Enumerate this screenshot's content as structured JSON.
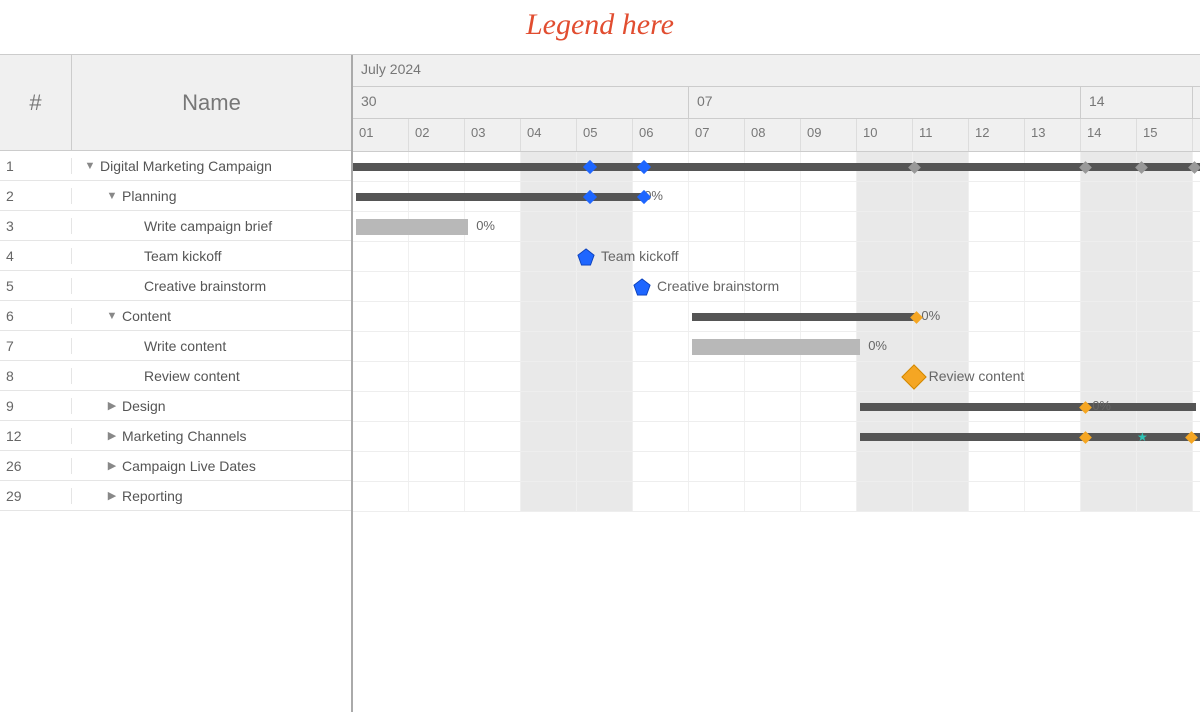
{
  "title": "Legend here",
  "columns": {
    "num": "#",
    "name": "Name"
  },
  "month": "July 2024",
  "weeks": [
    "30",
    "07",
    "14"
  ],
  "days": [
    "01",
    "02",
    "03",
    "04",
    "05",
    "06",
    "07",
    "08",
    "09",
    "10",
    "11",
    "12",
    "13",
    "14",
    "15"
  ],
  "weekend_day_indices": [
    3,
    4,
    9,
    10,
    13,
    14
  ],
  "rows": [
    {
      "num": "1",
      "indent": 0,
      "toggle": "down",
      "name": "Digital Marketing Campaign",
      "bar": {
        "type": "parent",
        "start": 0,
        "span": 15.5
      },
      "markers": [
        {
          "t": "dia-blue",
          "at": 4.15
        },
        {
          "t": "dia-blue",
          "at": 5.1
        },
        {
          "t": "dia-grey",
          "at": 9.95
        },
        {
          "t": "dia-grey",
          "at": 13.0
        },
        {
          "t": "dia-grey",
          "at": 14.0
        },
        {
          "t": "dia-grey",
          "at": 14.95
        }
      ]
    },
    {
      "num": "2",
      "indent": 1,
      "toggle": "down",
      "name": "Planning",
      "bar": {
        "type": "parent",
        "start": 0.05,
        "span": 5.1
      },
      "pct": {
        "val": "0%",
        "at": 5.2
      },
      "markers": [
        {
          "t": "dia-blue",
          "at": 4.15
        },
        {
          "t": "dia-blue",
          "at": 5.1
        }
      ]
    },
    {
      "num": "3",
      "indent": 2,
      "toggle": "",
      "name": "Write campaign brief",
      "bar": {
        "type": "light",
        "start": 0.05,
        "span": 2.0
      },
      "pct": {
        "val": "0%",
        "at": 2.2
      }
    },
    {
      "num": "4",
      "indent": 2,
      "toggle": "",
      "name": "Team kickoff",
      "milestone": {
        "shape": "pent-blue",
        "at": 4.0,
        "label": "Team kickoff"
      }
    },
    {
      "num": "5",
      "indent": 2,
      "toggle": "",
      "name": "Creative brainstorm",
      "milestone": {
        "shape": "pent-blue",
        "at": 5.0,
        "label": "Creative brainstorm"
      }
    },
    {
      "num": "6",
      "indent": 1,
      "toggle": "down",
      "name": "Content",
      "bar": {
        "type": "parent",
        "start": 6.05,
        "span": 4.0
      },
      "pct": {
        "val": "0%",
        "at": 10.15
      },
      "markers": [
        {
          "t": "dia-small-orange",
          "at": 9.98
        }
      ]
    },
    {
      "num": "7",
      "indent": 2,
      "toggle": "",
      "name": "Write content",
      "bar": {
        "type": "light",
        "start": 6.05,
        "span": 3.0
      },
      "pct": {
        "val": "0%",
        "at": 9.2
      }
    },
    {
      "num": "8",
      "indent": 2,
      "toggle": "",
      "name": "Review content",
      "milestone": {
        "shape": "dia-orange",
        "at": 9.85,
        "label": "Review content"
      }
    },
    {
      "num": "9",
      "indent": 1,
      "toggle": "right",
      "name": "Design",
      "bar": {
        "type": "parent",
        "start": 9.05,
        "span": 6.0
      },
      "pct": {
        "val": "0%",
        "at": 13.2
      },
      "markers": [
        {
          "t": "dia-small-orange",
          "at": 13.0
        }
      ]
    },
    {
      "num": "12",
      "indent": 1,
      "toggle": "right",
      "name": "Marketing Channels",
      "bar": {
        "type": "parent",
        "start": 9.05,
        "span": 6.5
      },
      "markers": [
        {
          "t": "dia-small-orange",
          "at": 13.0
        },
        {
          "t": "star",
          "at": 14.0
        },
        {
          "t": "dia-small-orange",
          "at": 14.9
        }
      ]
    },
    {
      "num": "26",
      "indent": 1,
      "toggle": "right",
      "name": "Campaign Live Dates"
    },
    {
      "num": "29",
      "indent": 1,
      "toggle": "right",
      "name": "Reporting"
    }
  ]
}
